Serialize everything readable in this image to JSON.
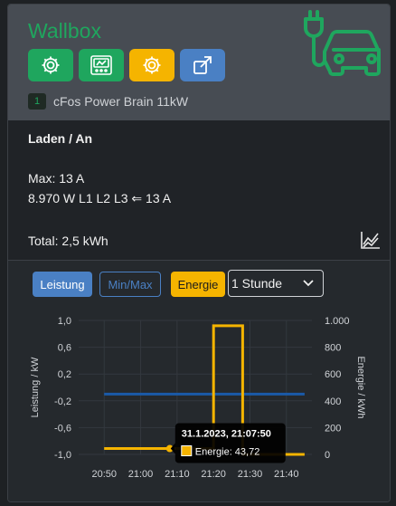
{
  "header": {
    "title": "Wallbox",
    "device_number": "1",
    "device_name": "cFos Power Brain 11kW",
    "buttons": [
      {
        "icon": "gear-icon",
        "color": "#1fa65e"
      },
      {
        "icon": "meter-icon",
        "color": "#1fa65e"
      },
      {
        "icon": "timer-gear-icon",
        "color": "#f5b400"
      },
      {
        "icon": "external-link-icon",
        "color": "#4a80c4"
      }
    ]
  },
  "status": {
    "state": "Laden / An",
    "max": "Max: 13 A",
    "power": "8.970 W L1 L2 L3 ⇐ 13 A",
    "total": "Total: 2,5 kWh"
  },
  "tabs": {
    "leistung": "Leistung",
    "minmax": "Min/Max",
    "energie": "Energie",
    "range_selected": "1 Stunde"
  },
  "chart_data": {
    "type": "line",
    "x_ticks": [
      "20:50",
      "21:00",
      "21:10",
      "21:20",
      "21:30",
      "21:40"
    ],
    "y_left": {
      "label": "Leistung / kW",
      "ticks": [
        "1,0",
        "0,6",
        "0,2",
        "-0,2",
        "-0,6",
        "-1,0"
      ],
      "range": [
        -1.0,
        1.0
      ]
    },
    "y_right": {
      "label": "Energie / kWh",
      "ticks": [
        "1.000",
        "800",
        "600",
        "400",
        "200",
        "0"
      ],
      "range": [
        0,
        1000
      ]
    },
    "series": [
      {
        "color": "#1a5aa8",
        "axis": "left",
        "x": [
          "20:50",
          "21:45"
        ],
        "values": [
          -0.1,
          -0.1
        ]
      },
      {
        "color": "#f5b400",
        "axis": "right",
        "x": [
          "20:50",
          "21:17",
          "21:20",
          "21:20",
          "21:28",
          "21:28",
          "21:31",
          "21:45"
        ],
        "values": [
          43.72,
          43.72,
          43.72,
          960,
          960,
          0,
          0,
          0
        ]
      }
    ],
    "tooltip": {
      "title": "31.1.2023, 21:07:50",
      "value": "Energie: 43,72",
      "color": "#f5b400"
    }
  }
}
